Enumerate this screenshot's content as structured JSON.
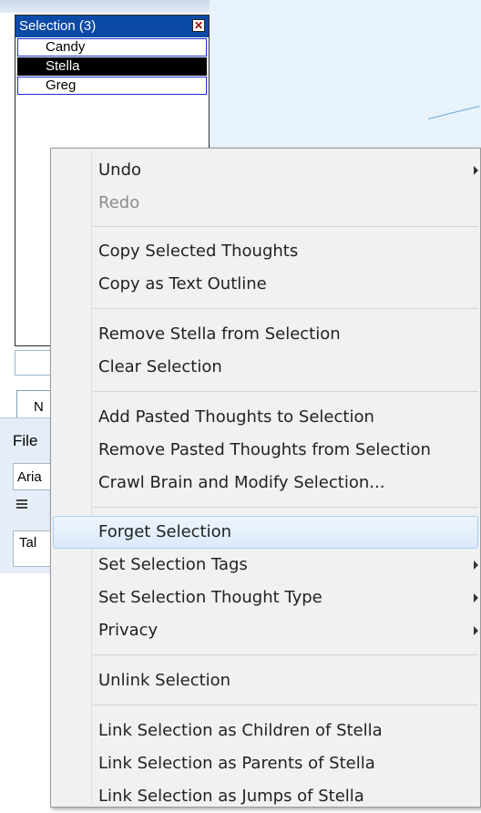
{
  "selection_panel": {
    "title": "Selection (3)",
    "close_glyph": "✕",
    "items": [
      "Candy",
      "Stella",
      "Greg"
    ]
  },
  "left_panel": {
    "tab_label": "N",
    "file_label": "File",
    "font_value": "Aria",
    "text_value": "Tal"
  },
  "menu": {
    "undo": "Undo",
    "redo": "Redo",
    "copy_selected": "Copy Selected Thoughts",
    "copy_outline": "Copy as Text Outline",
    "remove_stella": "Remove Stella from Selection",
    "clear_selection": "Clear Selection",
    "add_pasted": "Add Pasted Thoughts to Selection",
    "remove_pasted": "Remove Pasted Thoughts from Selection",
    "crawl_brain": "Crawl Brain and Modify Selection...",
    "forget_selection": "Forget Selection",
    "set_tags": "Set Selection Tags",
    "set_type": "Set Selection Thought Type",
    "privacy": "Privacy",
    "unlink": "Unlink Selection",
    "link_children": "Link Selection as Children of Stella",
    "link_parents": "Link Selection as Parents of Stella",
    "link_jumps": "Link Selection as Jumps of Stella"
  }
}
